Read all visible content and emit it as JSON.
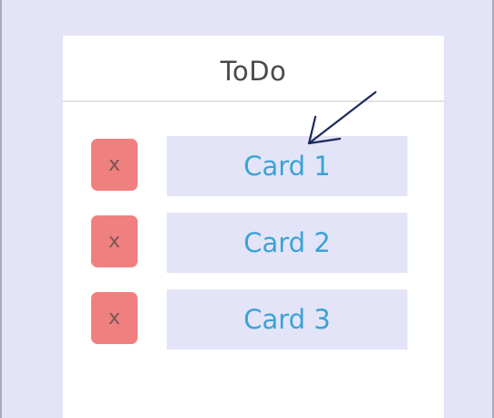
{
  "column": {
    "title": "ToDo",
    "cards": [
      {
        "label": "Card 1",
        "delete_label": "x"
      },
      {
        "label": "Card 2",
        "delete_label": "x"
      },
      {
        "label": "Card 3",
        "delete_label": "x"
      }
    ]
  },
  "colors": {
    "background": "#e4e4f8",
    "column_bg": "#ffffff",
    "card_bg": "#e4e4f8",
    "card_text": "#3aa3d6",
    "delete_bg": "#f08080",
    "title_text": "#4a4a4a",
    "arrow": "#1c2a5c"
  },
  "icons": {
    "pointer": "arrow-icon"
  }
}
